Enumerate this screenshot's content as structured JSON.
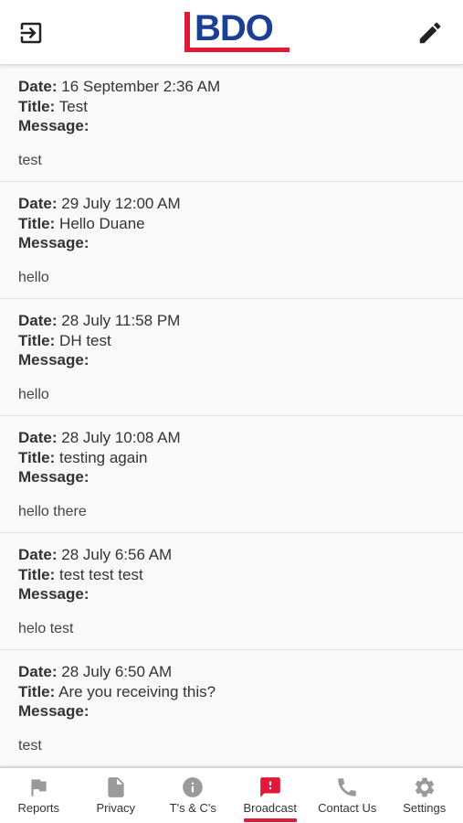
{
  "header": {
    "logo_text": "BDO",
    "logout_icon": "logout-icon",
    "compose_icon": "pencil-icon"
  },
  "labels": {
    "date": "Date:",
    "title": "Title:",
    "message": "Message:"
  },
  "messages": [
    {
      "date": "16 September 2:36 AM",
      "title": "Test",
      "body": "test"
    },
    {
      "date": "29 July 12:00 AM",
      "title": "Hello Duane",
      "body": "hello"
    },
    {
      "date": "28 July 11:58 PM",
      "title": "DH test",
      "body": "hello"
    },
    {
      "date": "28 July 10:08 AM",
      "title": "testing again",
      "body": "hello there"
    },
    {
      "date": "28 July 6:56 AM",
      "title": "test test test",
      "body": "helo test"
    },
    {
      "date": "28 July 6:50 AM",
      "title": "Are you receiving this?",
      "body": "test"
    }
  ],
  "tabs": [
    {
      "label": "Reports",
      "icon": "flag-icon"
    },
    {
      "label": "Privacy",
      "icon": "document-icon"
    },
    {
      "label": "T's & C's",
      "icon": "info-icon"
    },
    {
      "label": "Broadcast",
      "icon": "alert-chat-icon",
      "active": true
    },
    {
      "label": "Contact Us",
      "icon": "phone-icon"
    },
    {
      "label": "Settings",
      "icon": "gear-icon"
    }
  ],
  "colors": {
    "brand_blue": "#1b3f94",
    "brand_red": "#e31837",
    "icon_gray": "#9a9a9a",
    "text": "#333333"
  }
}
